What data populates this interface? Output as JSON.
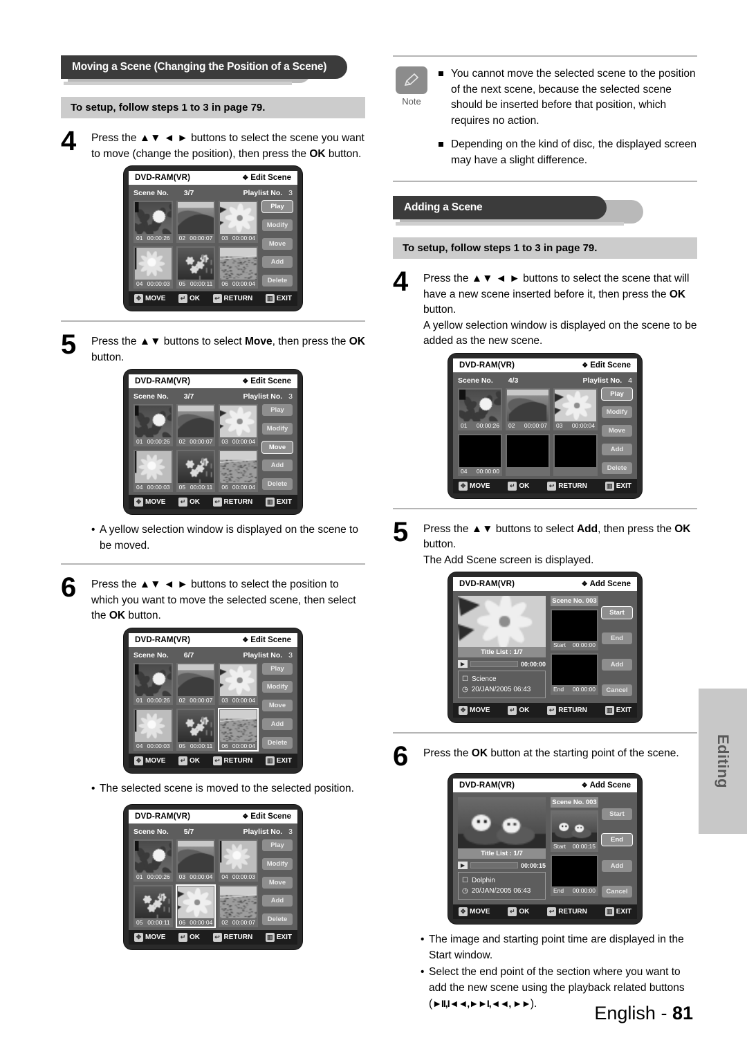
{
  "page": {
    "footer_language": "English - ",
    "footer_page": "81",
    "side_tab": "Editing"
  },
  "left_column": {
    "section_title": "Moving a Scene (Changing the Position of a Scene)",
    "setup_bar": "To setup, follow steps 1 to 3 in page 79.",
    "step4": {
      "num": "4",
      "text_a": "Press the ▲▼ ◄ ► buttons to select the scene you want to move (change the position), then press the ",
      "bold_ok": "OK",
      "text_b": " button."
    },
    "step5": {
      "num": "5",
      "text_a": "Press the ▲▼ buttons to select ",
      "bold_move": "Move",
      "text_b": ", then press the ",
      "bold_ok": "OK",
      "text_c": " button."
    },
    "bullet_yellow": "A yellow selection window is displayed on the scene to be moved.",
    "step6": {
      "num": "6",
      "text_a": "Press the ▲▼ ◄ ► buttons to select the position to which you want to move the selected scene, then select the ",
      "bold_ok": "OK",
      "text_b": " button."
    },
    "bullet_moved": "The selected scene is moved to the selected position."
  },
  "right_column": {
    "note_label": "Note",
    "note_items": [
      "You cannot move the selected scene to the position of the next scene, because the selected scene should be inserted before that position, which requires no action.",
      "Depending on the kind of disc, the displayed screen may have a slight difference."
    ],
    "section_title": "Adding a Scene",
    "setup_bar": "To setup, follow steps 1 to 3 in page 79.",
    "step4": {
      "num": "4",
      "text_a": "Press the ▲▼ ◄ ► buttons to select the scene that will have a new scene inserted before it, then press the ",
      "bold_ok": "OK",
      "text_b": " button.",
      "text_c": "A yellow selection window is displayed on the scene to be added as the new scene."
    },
    "step5": {
      "num": "5",
      "text_a": "Press the ▲▼ buttons to select ",
      "bold_add": "Add",
      "text_b": ", then press the ",
      "bold_ok": "OK",
      "text_c": " button.",
      "text_d": "The Add Scene screen is displayed."
    },
    "step6": {
      "num": "6",
      "text_a": "Press the ",
      "bold_ok": "OK",
      "text_b": " button at the starting point of the scene."
    },
    "bullet_start": "The image and starting point time are displayed in the Start window.",
    "bullet_end_a": "Select the end point of the section where you want to add the new scene using the playback related buttons (",
    "bullet_end_icons": "►ΙΙ,Ι◄◄,►►Ι,◄◄, ►►",
    "bullet_end_b": ")."
  },
  "osd_common": {
    "disc_label": "DVD-RAM(VR)",
    "title_edit": "Edit Scene",
    "title_add": "Add Scene",
    "diamond": "❖",
    "scene_no_label": "Scene No.",
    "playlist_label": "Playlist No.",
    "side_buttons": [
      "Play",
      "Modify",
      "Move",
      "Add",
      "Delete"
    ],
    "add_side_buttons": [
      "Start",
      "End",
      "Add",
      "Cancel"
    ],
    "footer_keys": [
      {
        "icon": "dpad-icon",
        "glyph": "✥",
        "label": "MOVE"
      },
      {
        "icon": "enter-icon",
        "glyph": "↵",
        "label": "OK"
      },
      {
        "icon": "return-icon",
        "glyph": "↩",
        "label": "RETURN"
      },
      {
        "icon": "exit-icon",
        "glyph": "▥",
        "label": "EXIT"
      }
    ]
  },
  "screens": {
    "left_1": {
      "name": "edit-scene-step4",
      "header": "Edit Scene",
      "scene_count": "3/7",
      "playlist_no": "3",
      "highlight_button": "Play",
      "selected_cell": -1,
      "cells": [
        {
          "no": "01",
          "time": "00:00:26",
          "img": "lotus"
        },
        {
          "no": "02",
          "time": "00:00:07",
          "img": "dolphin"
        },
        {
          "no": "03",
          "time": "00:00:04",
          "img": "lily"
        },
        {
          "no": "04",
          "time": "00:00:03",
          "img": "flower2"
        },
        {
          "no": "05",
          "time": "00:00:11",
          "img": "blossom"
        },
        {
          "no": "06",
          "time": "00:00:04",
          "img": "field"
        }
      ]
    },
    "left_2": {
      "name": "edit-scene-step5",
      "header": "Edit Scene",
      "scene_count": "3/7",
      "playlist_no": "3",
      "highlight_button": "Move",
      "selected_cell": -1,
      "cells": [
        {
          "no": "01",
          "time": "00:00:26",
          "img": "lotus"
        },
        {
          "no": "02",
          "time": "00:00:07",
          "img": "dolphin"
        },
        {
          "no": "03",
          "time": "00:00:04",
          "img": "lily"
        },
        {
          "no": "04",
          "time": "00:00:03",
          "img": "flower2"
        },
        {
          "no": "05",
          "time": "00:00:11",
          "img": "blossom"
        },
        {
          "no": "06",
          "time": "00:00:04",
          "img": "field"
        }
      ]
    },
    "left_3": {
      "name": "edit-scene-step6",
      "header": "Edit Scene",
      "scene_count": "6/7",
      "playlist_no": "3",
      "highlight_button": "",
      "selected_cell": 5,
      "cells": [
        {
          "no": "01",
          "time": "00:00:26",
          "img": "lotus"
        },
        {
          "no": "02",
          "time": "00:00:07",
          "img": "dolphin"
        },
        {
          "no": "03",
          "time": "00:00:04",
          "img": "lily"
        },
        {
          "no": "04",
          "time": "00:00:03",
          "img": "flower2"
        },
        {
          "no": "05",
          "time": "00:00:11",
          "img": "blossom"
        },
        {
          "no": "06",
          "time": "00:00:04",
          "img": "field"
        }
      ]
    },
    "left_4": {
      "name": "edit-scene-result",
      "header": "Edit Scene",
      "scene_count": "5/7",
      "playlist_no": "3",
      "highlight_button": "",
      "selected_cell": 4,
      "cells": [
        {
          "no": "01",
          "time": "00:00:26",
          "img": "lotus"
        },
        {
          "no": "03",
          "time": "00:00:04",
          "img": "dolphin"
        },
        {
          "no": "04",
          "time": "00:00:03",
          "img": "flower2"
        },
        {
          "no": "05",
          "time": "00:00:11",
          "img": "blossom"
        },
        {
          "no": "06",
          "time": "00:00:04",
          "img": "lily"
        },
        {
          "no": "02",
          "time": "00:00:07",
          "img": "field"
        }
      ]
    },
    "right_1": {
      "name": "add-scene-step4",
      "header": "Edit Scene",
      "scene_count": "4/3",
      "playlist_no": "4",
      "highlight_button": "Play",
      "selected_cell": -1,
      "cells": [
        {
          "no": "01",
          "time": "00:00:26",
          "img": "lotus"
        },
        {
          "no": "02",
          "time": "00:00:07",
          "img": "dolphin"
        },
        {
          "no": "03",
          "time": "00:00:04",
          "img": "lily"
        },
        {
          "no": "04",
          "time": "00:00:00",
          "img": "blank",
          "keepcap": true
        },
        {
          "no": "",
          "time": "",
          "img": "blank"
        },
        {
          "no": "",
          "time": "",
          "img": "blank"
        }
      ]
    },
    "right_2": {
      "name": "add-scene-screen-start",
      "header": "Add Scene",
      "scene_no": "Scene No. 003",
      "title_list": "Title List : 1/7",
      "seek_time": "00:00:00",
      "info_title": "Science",
      "info_date": "20/JAN/2005 06:43",
      "start_label": "Start",
      "start_time": "00:00:00",
      "end_label": "End",
      "end_time": "00:00:00",
      "preview_img": "lily",
      "start_img": "blank",
      "end_img": "blank",
      "highlight_button": "Start"
    },
    "right_3": {
      "name": "add-scene-screen-end",
      "header": "Add Scene",
      "scene_no": "Scene No. 003",
      "title_list": "Title List : 1/7",
      "seek_time": "00:00:15",
      "info_title": "Dolphin",
      "info_date": "20/JAN/2005 06:43",
      "start_label": "Start",
      "start_time": "00:00:15",
      "end_label": "End",
      "end_time": "00:00:00",
      "preview_img": "otters",
      "start_img": "otters",
      "end_img": "blank",
      "highlight_button": "End"
    }
  }
}
